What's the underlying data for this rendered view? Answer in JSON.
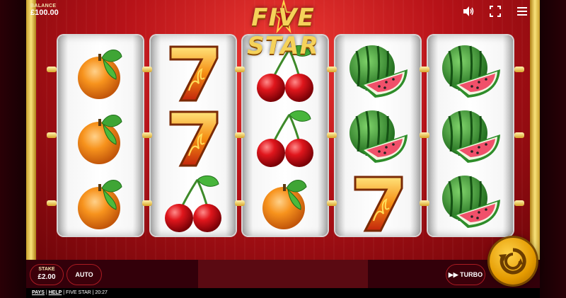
{
  "game": {
    "title": "FIVE STAR"
  },
  "balance": {
    "label": "BALANCE",
    "value": "£100.00"
  },
  "top_icons": [
    "sound-icon",
    "fullscreen-icon",
    "menu-icon"
  ],
  "reels": [
    [
      "orange",
      "orange",
      "orange"
    ],
    [
      "seven",
      "seven",
      "cherry"
    ],
    [
      "cherry",
      "cherry",
      "orange"
    ],
    [
      "watermelon",
      "watermelon",
      "seven"
    ],
    [
      "watermelon",
      "watermelon",
      "watermelon"
    ]
  ],
  "controls": {
    "stake_label": "STAKE",
    "stake_value": "£2.00",
    "auto_label": "AUTO",
    "turbo_label": "TURBO"
  },
  "footer": {
    "pays": "PAYS",
    "sep1": " | ",
    "help": "HELP",
    "sep2": " | ",
    "game_name": "FIVE STAR",
    "sep3": " | ",
    "time": "20:27"
  },
  "colors": {
    "accent_gold": "#f5d25a",
    "background_red": "#b71218",
    "spin_gold": "#e49a00"
  }
}
